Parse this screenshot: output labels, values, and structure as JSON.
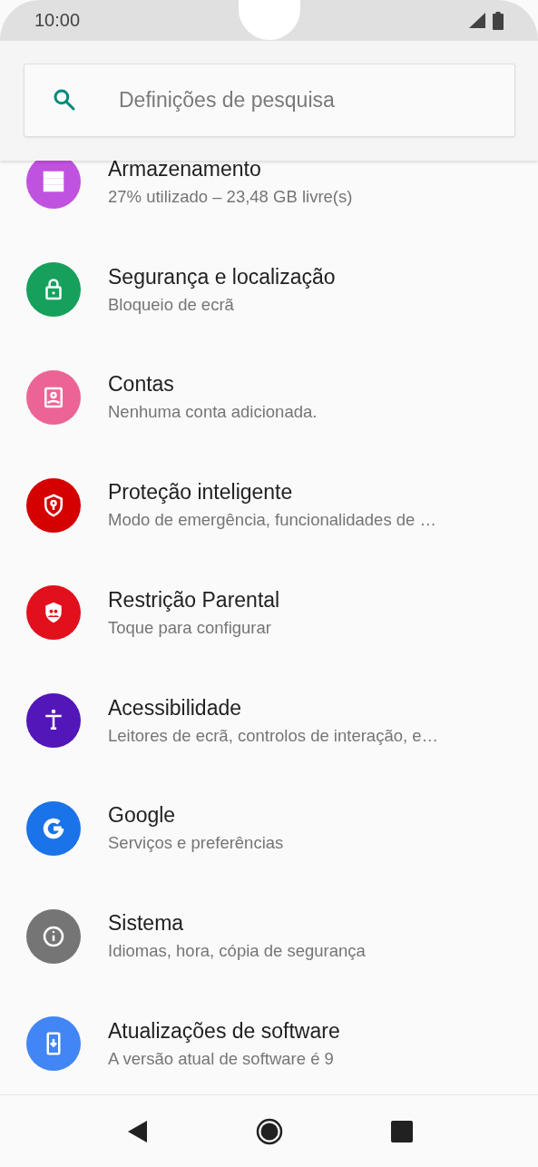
{
  "status_bar": {
    "time": "10:00"
  },
  "search": {
    "placeholder": "Definições de pesquisa"
  },
  "settings": [
    {
      "title": "Armazenamento",
      "subtitle": "27% utilizado – 23,48 GB livre(s)",
      "color": "#c052e0"
    },
    {
      "title": "Segurança e localização",
      "subtitle": "Bloqueio de ecrã",
      "color": "#16a05c"
    },
    {
      "title": "Contas",
      "subtitle": "Nenhuma conta adicionada.",
      "color": "#ec6495"
    },
    {
      "title": "Proteção inteligente",
      "subtitle": "Modo de emergência, funcionalidades de …",
      "color": "#d50000"
    },
    {
      "title": "Restrição Parental",
      "subtitle": "Toque para configurar",
      "color": "#e2101d"
    },
    {
      "title": "Acessibilidade",
      "subtitle": "Leitores de ecrã, controlos de interação, e…",
      "color": "#5316b9"
    },
    {
      "title": "Google",
      "subtitle": "Serviços e preferências",
      "color": "#1a73e8"
    },
    {
      "title": "Sistema",
      "subtitle": "Idiomas, hora, cópia de segurança",
      "color": "#757575"
    },
    {
      "title": "Atualizações de software",
      "subtitle": "A versão atual de software é 9",
      "color": "#4285f4"
    }
  ]
}
